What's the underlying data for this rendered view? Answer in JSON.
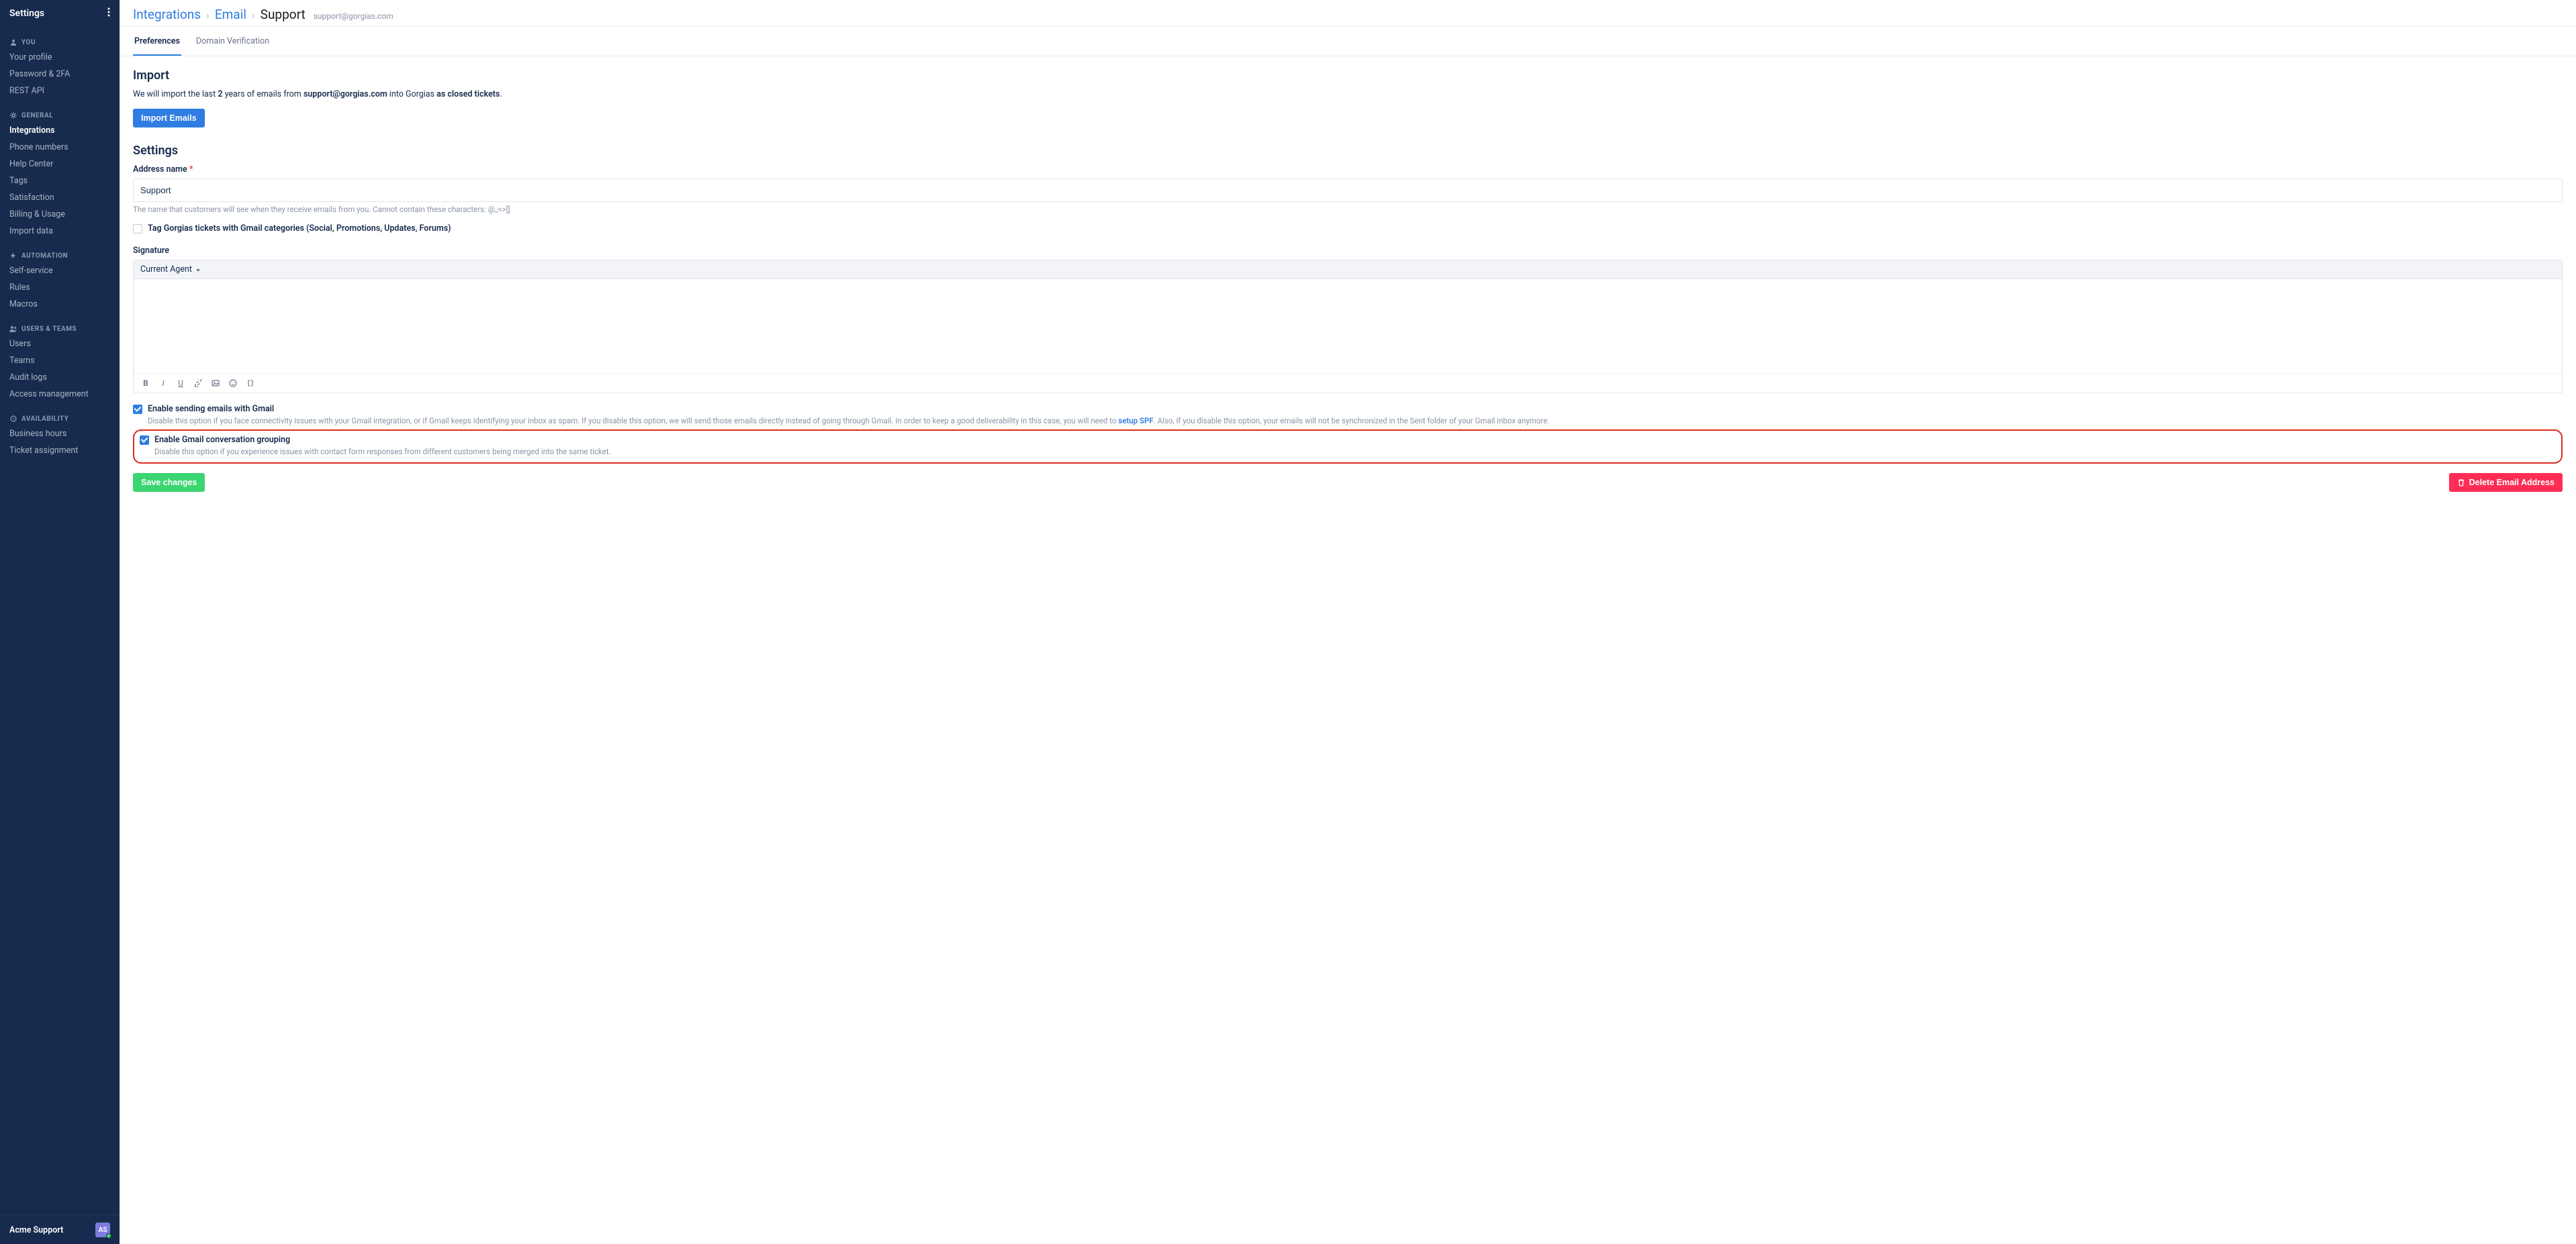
{
  "sidebar": {
    "title": "Settings",
    "sections": [
      {
        "header": "YOU",
        "icon": "person",
        "items": [
          "Your profile",
          "Password & 2FA",
          "REST API"
        ]
      },
      {
        "header": "GENERAL",
        "icon": "gear",
        "items": [
          "Integrations",
          "Phone numbers",
          "Help Center",
          "Tags",
          "Satisfaction",
          "Billing & Usage",
          "Import data"
        ],
        "activeIndex": 0
      },
      {
        "header": "AUTOMATION",
        "icon": "bolt",
        "items": [
          "Self-service",
          "Rules",
          "Macros"
        ]
      },
      {
        "header": "USERS & TEAMS",
        "icon": "people",
        "items": [
          "Users",
          "Teams",
          "Audit logs",
          "Access management"
        ]
      },
      {
        "header": "AVAILABILITY",
        "icon": "clock",
        "items": [
          "Business hours",
          "Ticket assignment"
        ]
      }
    ],
    "footer": {
      "org": "Acme Support",
      "avatar_initials": "AS"
    }
  },
  "breadcrumb": {
    "l1": "Integrations",
    "l2": "Email",
    "l3": "Support",
    "sub": "support@gorgias.com"
  },
  "tabs": {
    "active": "Preferences",
    "other": "Domain Verification"
  },
  "import": {
    "heading": "Import",
    "text_pre": "We will import the last ",
    "years": "2",
    "text_mid": " years of emails from ",
    "email": "support@gorgias.com",
    "text_into": " into Gorgias ",
    "text_closed": "as closed tickets",
    "text_period": ".",
    "button": "Import Emails"
  },
  "settings": {
    "heading": "Settings",
    "address_label": "Address name",
    "address_value": "Support",
    "address_help": "The name that customers will see when they receive emails from you. Cannot contain these characters: @,;<>[]",
    "tag_checkbox_label": "Tag Gorgias tickets with Gmail categories (Social, Promotions, Updates, Forums)",
    "signature_label": "Signature",
    "signature_dropdown": "Current Agent",
    "enable_send_label": "Enable sending emails with Gmail",
    "enable_send_help_1": "Disable this option if you face connectivity issues with your Gmail integration, or if Gmail keeps identifying your inbox as spam. If you disable this option, we will send those emails directly instead of going through Gmail. In order to keep a good deliverability in this case, you will need to ",
    "enable_send_link": "setup SPF",
    "enable_send_help_2": ". Also, if you disable this option, your emails will not be synchronized in the Sent folder of your Gmail inbox anymore.",
    "enable_group_label": "Enable Gmail conversation grouping",
    "enable_group_help": "Disable this option if you experience issues with contact form responses from different customers being merged into the same ticket."
  },
  "actions": {
    "save": "Save changes",
    "delete": "Delete Email Address"
  }
}
